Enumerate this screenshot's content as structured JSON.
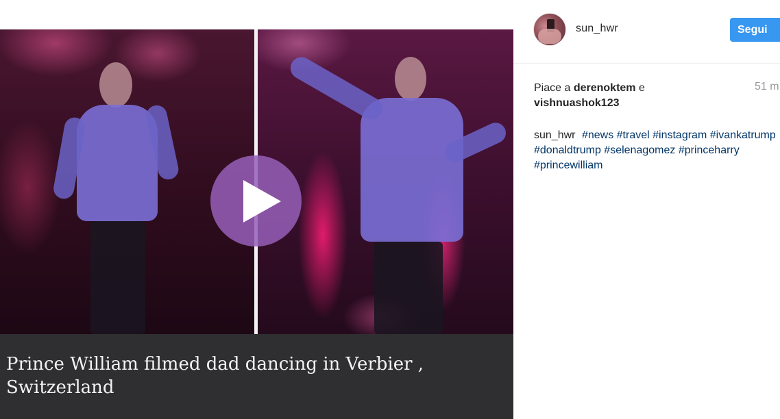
{
  "post": {
    "caption": "Prince William filmed dad dancing in Verbier , Switzerland"
  },
  "header": {
    "username": "sun_hwr",
    "follow_label": "Segui"
  },
  "likes": {
    "prefix": "Piace a",
    "user1": "derenoktem",
    "conjunction": "e",
    "user2": "vishnuashok123",
    "time": "51 m"
  },
  "comment": {
    "username": "sun_hwr",
    "hashtags": [
      "#news",
      "#travel",
      "#instagram",
      "#ivankatrump",
      "#donaldtrump",
      "#selenagomez",
      "#princeharry",
      "#princewilliam"
    ]
  },
  "colors": {
    "follow_button": "#3897f0",
    "hashtag": "#003569",
    "play_button": "#965fb9",
    "caption_bar": "#2f2f31"
  }
}
